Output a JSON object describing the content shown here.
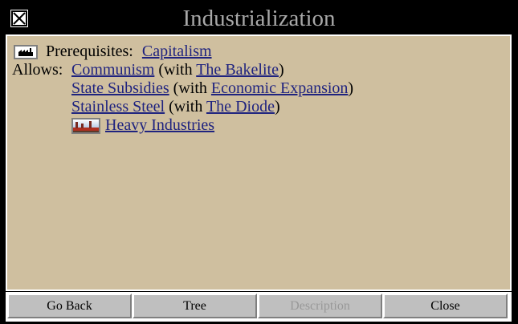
{
  "window": {
    "title": "Industrialization"
  },
  "prereq": {
    "label": "Prerequisites:",
    "link": "Capitalism",
    "icon": "factory-icon"
  },
  "allows": {
    "label": "Allows:",
    "items": [
      {
        "name": "Communism",
        "with_prefix": "(with",
        "with": "The Bakelite",
        "suffix": ")"
      },
      {
        "name": "State Subsidies",
        "with_prefix": "(with",
        "with": "Economic Expansion",
        "suffix": ")"
      },
      {
        "name": "Stainless Steel",
        "with_prefix": "(with",
        "with": "The Diode",
        "suffix": ")"
      }
    ],
    "improvement": {
      "name": "Heavy Industries",
      "icon": "heavy-industries-icon"
    }
  },
  "buttons": {
    "go_back": "Go Back",
    "tree": "Tree",
    "description": "Description",
    "close": "Close"
  },
  "colors": {
    "panel": "#cfbf9f",
    "link": "#1f237f",
    "title": "#a8a8a8",
    "button": "#bfbfbf"
  }
}
